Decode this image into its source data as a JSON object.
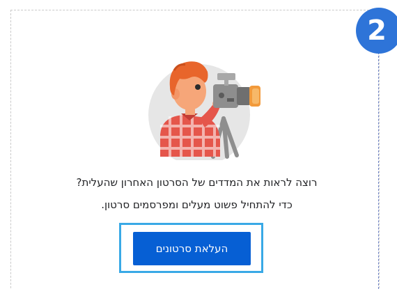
{
  "step": {
    "number": "2"
  },
  "illustration": {
    "subject": "videographer-with-camera-icon"
  },
  "empty_state": {
    "line1": "רוצה לראות את המדדים של הסרטון האחרון שהעלית?",
    "line2": "כדי להתחיל פשוט מעלים ומפרסמים סרטון."
  },
  "actions": {
    "upload_label": "העלאת סרטונים"
  },
  "colors": {
    "step_badge": "#2e74d8",
    "button": "#065fd4",
    "highlight": "#39a9e6",
    "character_hair": "#e8652b",
    "shirt_check": "#e5564b"
  }
}
